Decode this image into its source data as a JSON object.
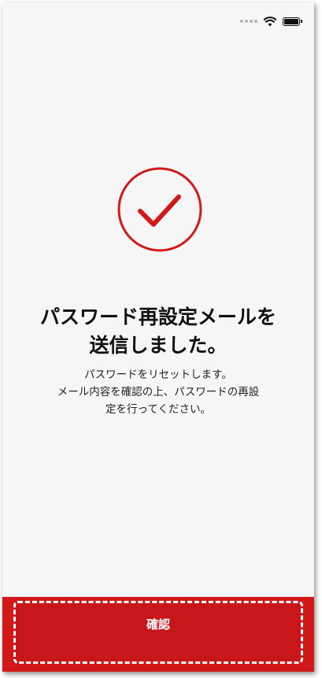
{
  "status_bar": {
    "wifi_icon": "wifi-icon",
    "battery_icon": "battery-icon"
  },
  "success_icon": "check-circle-icon",
  "title": {
    "line1": "パスワード再設定メールを",
    "line2": "送信しました。"
  },
  "message": {
    "line1": "パスワードをリセットします。",
    "line2": "メール内容を確認の上、パスワードの再設",
    "line3": "定を行ってください。"
  },
  "confirm_button": {
    "label": "確認"
  },
  "colors": {
    "accent": "#d21919",
    "background": "#f6f6f6",
    "text": "#111111"
  }
}
